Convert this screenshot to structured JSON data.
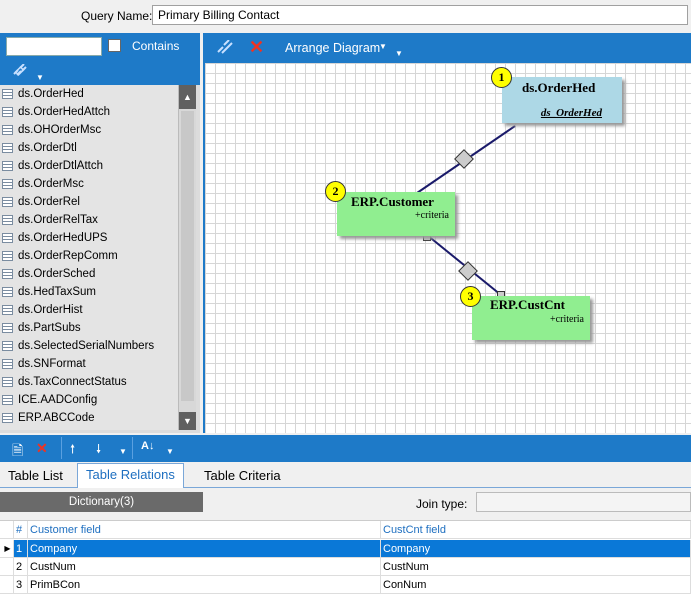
{
  "query": {
    "label": "Query Name:",
    "value": "Primary Billing Contact"
  },
  "left_panel": {
    "search_value": "",
    "contains_label": "Contains",
    "tables": [
      "ds.OrderHed",
      "ds.OrderHedAttch",
      "ds.OHOrderMsc",
      "ds.OrderDtl",
      "ds.OrderDtlAttch",
      "ds.OrderMsc",
      "ds.OrderRel",
      "ds.OrderRelTax",
      "ds.OrderHedUPS",
      "ds.OrderRepComm",
      "ds.OrderSched",
      "ds.HedTaxSum",
      "ds.OrderHist",
      "ds.PartSubs",
      "ds.SelectedSerialNumbers",
      "ds.SNFormat",
      "ds.TaxConnectStatus",
      "ICE.AADConfig",
      "ERP.ABCCode"
    ]
  },
  "diagram": {
    "arrange_label": "Arrange Diagram",
    "nodes": [
      {
        "badge": "1",
        "title": "ds.OrderHed",
        "sub": "ds_OrderHed",
        "color": "#add8e6"
      },
      {
        "badge": "2",
        "title": "ERP.Customer",
        "sub": "+criteria",
        "color": "#90ee90"
      },
      {
        "badge": "3",
        "title": "ERP.CustCnt",
        "sub": "+criteria",
        "color": "#90ee90"
      }
    ]
  },
  "tabs": [
    "Table List",
    "Table Relations",
    "Table Criteria"
  ],
  "active_tab": "Table Relations",
  "dictionary_label": "Dictionary(3)",
  "join_type_label": "Join type:",
  "grid": {
    "headers": [
      "#",
      "Customer field",
      "CustCnt field"
    ],
    "rows": [
      {
        "n": "1",
        "left": "Company",
        "right": "Company"
      },
      {
        "n": "2",
        "left": "CustNum",
        "right": "CustNum"
      },
      {
        "n": "3",
        "left": "PrimBCon",
        "right": "ConNum"
      }
    ]
  },
  "colors": {
    "accent": "#1e7ac8",
    "selection": "#0a78d7"
  }
}
